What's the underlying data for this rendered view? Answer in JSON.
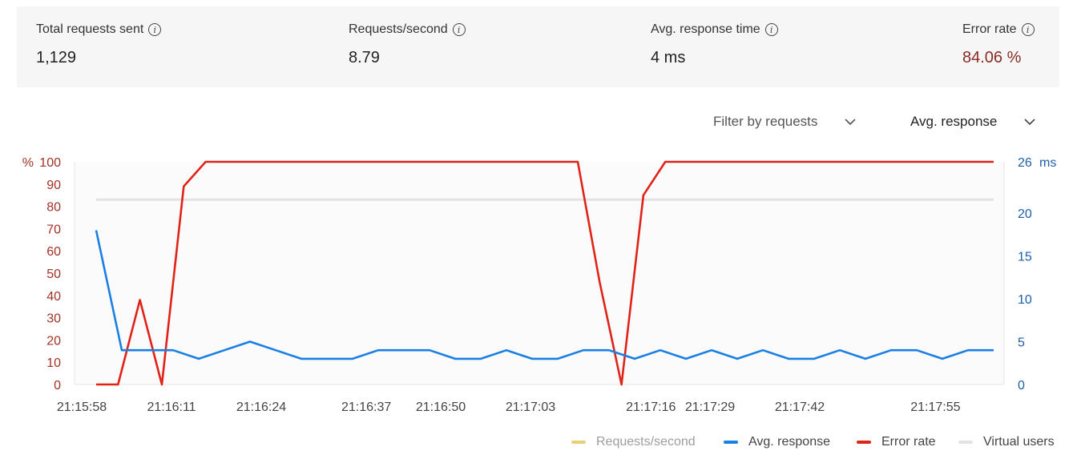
{
  "stats": [
    {
      "label": "Total requests sent",
      "value": "1,129",
      "color": "#222222"
    },
    {
      "label": "Requests/second",
      "value": "8.79",
      "color": "#222222"
    },
    {
      "label": "Avg. response time",
      "value": "4 ms",
      "color": "#222222"
    },
    {
      "label": "Error rate",
      "value": "84.06 %",
      "color": "#8a2b22"
    }
  ],
  "filters": {
    "requests_label": "Filter by requests",
    "metric_label": "Avg. response"
  },
  "legend": [
    {
      "label": "Requests/second",
      "color": "#e8cf7a",
      "text_color": "#9e9e9e"
    },
    {
      "label": "Avg. response",
      "color": "#1a7fe3",
      "text_color": "#444444"
    },
    {
      "label": "Error rate",
      "color": "#e02318",
      "text_color": "#444444"
    },
    {
      "label": "Virtual users",
      "color": "#e3e3e3",
      "text_color": "#444444"
    }
  ],
  "chart_data": {
    "type": "line",
    "x": [
      "21:15:58",
      "21:16:01",
      "21:16:04",
      "21:16:07",
      "21:16:10",
      "21:16:13",
      "21:16:16",
      "21:16:19",
      "21:16:22",
      "21:16:25",
      "21:16:28",
      "21:16:31",
      "21:16:34",
      "21:16:37",
      "21:16:40",
      "21:16:43",
      "21:16:46",
      "21:16:49",
      "21:16:52",
      "21:16:55",
      "21:16:58",
      "21:17:01",
      "21:17:04",
      "21:17:07",
      "21:17:10",
      "21:17:13",
      "21:17:16",
      "21:17:19",
      "21:17:22",
      "21:17:25",
      "21:17:28",
      "21:17:31",
      "21:17:34",
      "21:17:37",
      "21:17:40",
      "21:17:43",
      "21:17:46",
      "21:17:49",
      "21:17:52",
      "21:17:55",
      "21:17:58",
      "21:18:01"
    ],
    "x_tick_labels": [
      "21:15:58",
      "21:16:11",
      "21:16:24",
      "21:16:37",
      "21:16:50",
      "21:17:03",
      "21:17:16",
      "21:17:29",
      "21:17:42",
      "21:17:55"
    ],
    "series": [
      {
        "name": "Error rate",
        "axis": "left",
        "color": "#e02318",
        "values": [
          0,
          0,
          38,
          0,
          89,
          100,
          100,
          100,
          100,
          100,
          100,
          100,
          100,
          100,
          100,
          100,
          100,
          100,
          100,
          100,
          100,
          100,
          100,
          46,
          0,
          85,
          100,
          100,
          100,
          100,
          100,
          100,
          100,
          100,
          100,
          100,
          100,
          100,
          100,
          100,
          100,
          100
        ]
      },
      {
        "name": "Avg. response",
        "axis": "right",
        "color": "#1a7fe3",
        "values": [
          18,
          4,
          4,
          4,
          3,
          4,
          5,
          4,
          3,
          3,
          3,
          4,
          4,
          4,
          3,
          3,
          4,
          3,
          3,
          4,
          4,
          3,
          4,
          3,
          4,
          3,
          4,
          3,
          3,
          4,
          3,
          4,
          4,
          3,
          4,
          4
        ]
      },
      {
        "name": "Virtual users",
        "axis": "left",
        "color": "#e3e3e3",
        "values": [
          83,
          83,
          83,
          83,
          83,
          83,
          83,
          83,
          83,
          83,
          83,
          83,
          83,
          83,
          83,
          83,
          83,
          83,
          83,
          83,
          83,
          83,
          83,
          83,
          83,
          83,
          83,
          83,
          83,
          83,
          83,
          83,
          83,
          83,
          83,
          83,
          83,
          83,
          83,
          83,
          83,
          83
        ]
      }
    ],
    "y_left": {
      "ticks": [
        "0",
        "10",
        "20",
        "30",
        "40",
        "50",
        "60",
        "70",
        "80",
        "90",
        "100"
      ],
      "unit": "%",
      "ylim": [
        0,
        100
      ],
      "color": "#a33226"
    },
    "y_right": {
      "ticks": [
        "0",
        "5",
        "10",
        "15",
        "20",
        "26"
      ],
      "unit": "ms",
      "ylim": [
        0,
        26
      ],
      "color": "#1f5fa8"
    }
  }
}
